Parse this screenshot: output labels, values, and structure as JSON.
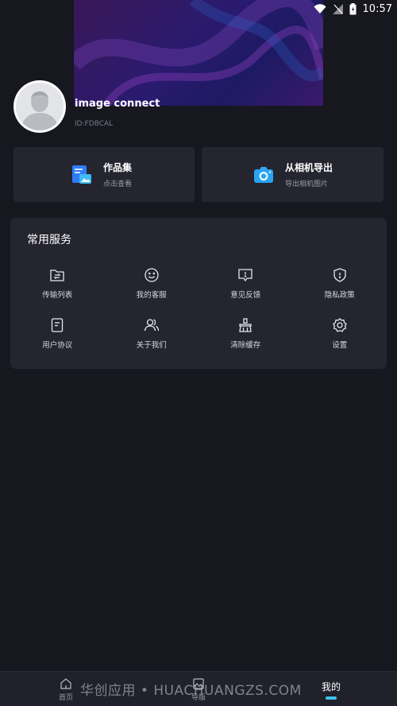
{
  "status_bar": {
    "time": "10:57",
    "icons": [
      "wifi-icon",
      "signal-icon",
      "battery-icon"
    ]
  },
  "profile": {
    "name": "image connect",
    "id": "ID:FDBCAL"
  },
  "cards": [
    {
      "title": "作品集",
      "subtitle": "点击查看",
      "icon": "portfolio-icon"
    },
    {
      "title": "从相机导出",
      "subtitle": "导出相机图片",
      "icon": "camera-icon"
    }
  ],
  "services": {
    "title": "常用服务",
    "items": [
      {
        "label": "传输列表",
        "icon": "transfer-list-icon"
      },
      {
        "label": "我的客服",
        "icon": "customer-service-icon"
      },
      {
        "label": "意见反馈",
        "icon": "feedback-icon"
      },
      {
        "label": "隐私政策",
        "icon": "privacy-shield-icon"
      },
      {
        "label": "用户协议",
        "icon": "agreement-icon"
      },
      {
        "label": "关于我们",
        "icon": "about-us-icon"
      },
      {
        "label": "清除缓存",
        "icon": "clear-cache-icon"
      },
      {
        "label": "设置",
        "icon": "settings-gear-icon"
      }
    ]
  },
  "bottom_nav": {
    "items": [
      {
        "label": "首页",
        "icon": "home-icon"
      },
      {
        "label": "导版",
        "icon": "picture-icon"
      },
      {
        "label": "我的",
        "active": true
      }
    ],
    "accent": "#3ec3f0"
  },
  "watermark": "华创应用 • HUACHUANGZS.COM",
  "colors": {
    "background": "#17171f",
    "card": "#24252f",
    "accent": "#3ec3f0"
  }
}
